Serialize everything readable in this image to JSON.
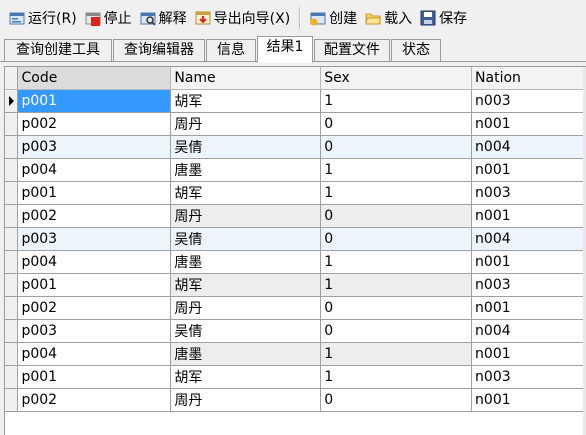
{
  "toolbar": {
    "run": {
      "label": "运行(R)",
      "icon": "run-icon"
    },
    "stop": {
      "label": "停止",
      "icon": "stop-icon"
    },
    "explain": {
      "label": "解释",
      "icon": "explain-icon"
    },
    "export": {
      "label": "导出向导(X)",
      "icon": "export-icon"
    },
    "create": {
      "label": "创建",
      "icon": "create-icon"
    },
    "load": {
      "label": "载入",
      "icon": "folder-icon"
    },
    "save": {
      "label": "保存",
      "icon": "save-icon"
    }
  },
  "tabs": [
    {
      "label": "查询创建工具"
    },
    {
      "label": "查询编辑器"
    },
    {
      "label": "信息"
    },
    {
      "label": "结果1"
    },
    {
      "label": "配置文件"
    },
    {
      "label": "状态"
    }
  ],
  "grid": {
    "columns": [
      "Code",
      "Name",
      "Sex",
      "Nation"
    ],
    "rows": [
      [
        "p001",
        "胡军",
        "1",
        "n003"
      ],
      [
        "p002",
        "周丹",
        "0",
        "n001"
      ],
      [
        "p003",
        "吴倩",
        "0",
        "n004"
      ],
      [
        "p004",
        "唐墨",
        "1",
        "n001"
      ],
      [
        "p001",
        "胡军",
        "1",
        "n003"
      ],
      [
        "p002",
        "周丹",
        "0",
        "n001"
      ],
      [
        "p003",
        "吴倩",
        "0",
        "n004"
      ],
      [
        "p004",
        "唐墨",
        "1",
        "n001"
      ],
      [
        "p001",
        "胡军",
        "1",
        "n003"
      ],
      [
        "p002",
        "周丹",
        "0",
        "n001"
      ],
      [
        "p003",
        "吴倩",
        "0",
        "n004"
      ],
      [
        "p004",
        "唐墨",
        "1",
        "n001"
      ],
      [
        "p001",
        "胡军",
        "1",
        "n003"
      ],
      [
        "p002",
        "周丹",
        "0",
        "n001"
      ]
    ]
  },
  "colors": {
    "selection": "#3399ff",
    "alt_row": "#edf4fb",
    "toolbar_bg": "#f0f0f0"
  }
}
